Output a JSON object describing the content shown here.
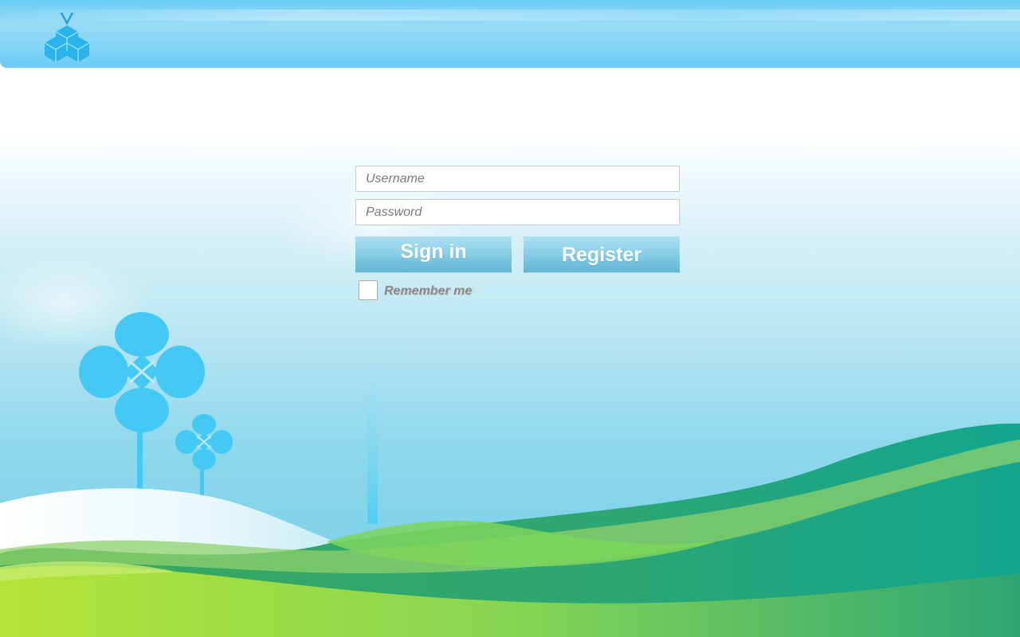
{
  "login": {
    "username_placeholder": "Username",
    "password_placeholder": "Password",
    "signin_label": "Sign in",
    "register_label": "Register",
    "remember_label": "Remember me",
    "remember_checked": false
  },
  "icons": {
    "logo": "cube-cluster-logo-icon",
    "flower_large": "flower-icon",
    "flower_small": "flower-icon"
  },
  "colors": {
    "header": "#6dcdf3",
    "button": "#7cc6e3",
    "flower": "#44c9f5",
    "hill_green": "#5bc36a",
    "hill_teal": "#13a88f",
    "hill_lime": "#b4e437"
  }
}
